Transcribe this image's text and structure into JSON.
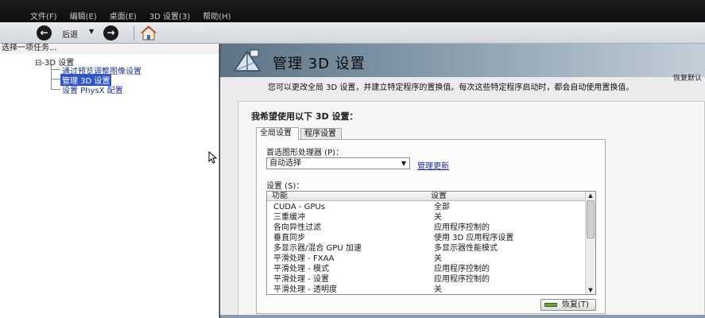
{
  "menu": {
    "items": [
      "文件(F)",
      "编辑(E)",
      "桌面(E)",
      "3D 设置(3)",
      "帮助(H)"
    ]
  },
  "toolbar": {
    "back_label": "后退",
    "icons": [
      "back-arrow-icon",
      "chevron-down-icon",
      "forward-arrow-icon",
      "home-icon"
    ]
  },
  "sidebar": {
    "header": "选择一项任务...",
    "root_label": "3D 设置",
    "items": [
      {
        "label": "通过预览调整图像设置"
      },
      {
        "label": "管理 3D 设置",
        "selected": true
      },
      {
        "label": "设置 PhysX 配置"
      }
    ]
  },
  "page": {
    "title": "管理 3D 设置",
    "restore_defaults": "恢复默认",
    "description": "您可以更改全局 3D 设置，并建立特定程序的置换值。每次这些特定程序启动时，都会自动使用置换值。",
    "section_title": "我希望使用以下 3D 设置：",
    "tabs": [
      {
        "label": "全局设置",
        "active": true
      },
      {
        "label": "程序设置",
        "active": false
      }
    ],
    "processor_label": "首选图形处理器 (P)：",
    "processor_value": "自动选择",
    "manage_link": "管理更新",
    "settings_label": "设置 (S)：",
    "table": {
      "columns": [
        "功能",
        "设置"
      ],
      "rows": [
        {
          "feature": "CUDA - GPUs",
          "setting": "全部"
        },
        {
          "feature": "三重缓冲",
          "setting": "关"
        },
        {
          "feature": "各向异性过滤",
          "setting": "应用程序控制的"
        },
        {
          "feature": "垂直同步",
          "setting": "使用 3D 应用程序设置"
        },
        {
          "feature": "多显示器/混合 GPU 加速",
          "setting": "多显示器性能模式"
        },
        {
          "feature": "平滑处理 - FXAA",
          "setting": "关"
        },
        {
          "feature": "平滑处理 - 模式",
          "setting": "应用程序控制的"
        },
        {
          "feature": "平滑处理 - 设置",
          "setting": "应用程序控制的"
        },
        {
          "feature": "平滑处理 - 透明度",
          "setting": "关"
        }
      ]
    },
    "restore_button": "恢复(T)"
  },
  "colors": {
    "menubar": "#121212",
    "selection": "#2f55c8",
    "link": "#1a2f96",
    "banner": "#7f93a5"
  }
}
